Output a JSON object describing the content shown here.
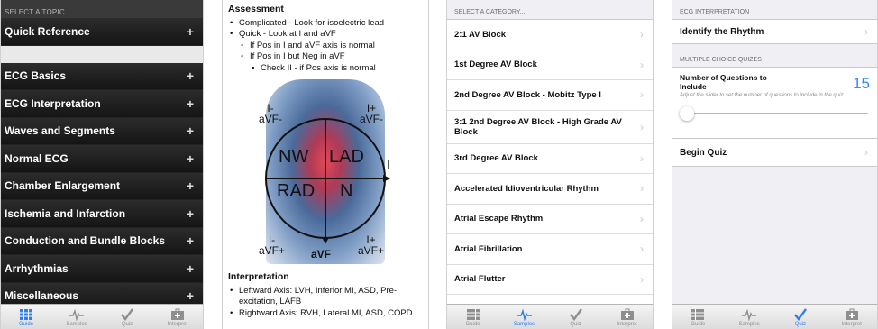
{
  "guide_panel": {
    "header": "SELECT A TOPIC...",
    "quick_reference": "Quick Reference",
    "topics": [
      "ECG Basics",
      "ECG Interpretation",
      "Waves and Segments",
      "Normal ECG",
      "Chamber Enlargement",
      "Ischemia and Infarction",
      "Conduction and Bundle Blocks",
      "Arrhythmias",
      "Miscellaneous"
    ],
    "plus_glyph": "+"
  },
  "reference_panel": {
    "assessment_title": "Assessment",
    "bullets": [
      "Complicated - Look for isoelectric lead",
      "Quick - Look at I and aVF",
      "If Pos in I and aVF axis is normal",
      "If Pos in I but Neg in aVF",
      "Check II - if Pos axis is normal"
    ],
    "figure": {
      "top_left": "I-",
      "top_left_2": "aVF-",
      "top_right": "I+",
      "top_right_2": "aVF-",
      "bottom_left": "I-",
      "bottom_left_2": "aVF+",
      "bottom_center": "aVF",
      "bottom_right": "I+",
      "bottom_right_2": "aVF+",
      "quadrant_nw": "NW",
      "quadrant_lad": "LAD",
      "quadrant_rad": "RAD",
      "quadrant_n": "N",
      "right_tick": "I"
    },
    "interpretation_title": "Interpretation",
    "interpretation_bullets": [
      "Leftward Axis: LVH, Inferior MI, ASD, Pre-excitation, LAFB",
      "Rightward Axis: RVH, Lateral MI, ASD, COPD"
    ]
  },
  "samples_panel": {
    "header": "SELECT A CATEGORY...",
    "categories": [
      "2:1 AV Block",
      "1st Degree AV Block",
      "2nd Degree AV Block - Mobitz Type I",
      "3:1 2nd Degree AV Block - High Grade AV Block",
      "3rd Degree AV Block",
      "Accelerated Idioventricular Rhythm",
      "Atrial Escape Rhythm",
      "Atrial Fibrillation",
      "Atrial Flutter"
    ],
    "chevron": "›"
  },
  "quiz_panel": {
    "section_interpretation": "ECG INTERPRETATION",
    "identify_rhythm": "Identify the Rhythm",
    "section_mcq": "MULTIPLE CHOICE QUIZES",
    "num_questions_label": "Number of Questions to Include",
    "num_questions_value": "15",
    "slider_hint": "Adjust the slider to set the number of questions to include in the quiz",
    "slider_fraction": 0.0,
    "begin_quiz": "Begin Quiz",
    "chevron": "›"
  },
  "tabbar": {
    "tabs": [
      {
        "label": "Guide",
        "icon": "guide-grid-icon"
      },
      {
        "label": "Samples",
        "icon": "ecg-wave-icon"
      },
      {
        "label": "Quiz",
        "icon": "checkmark-icon"
      },
      {
        "label": "Interpret",
        "icon": "medical-kit-icon"
      }
    ],
    "active_color": "#2f7df0",
    "inactive_color": "#8e8e8e"
  },
  "colors": {
    "accent": "#2f8cf0",
    "dark_row": "#1f1f1f"
  }
}
